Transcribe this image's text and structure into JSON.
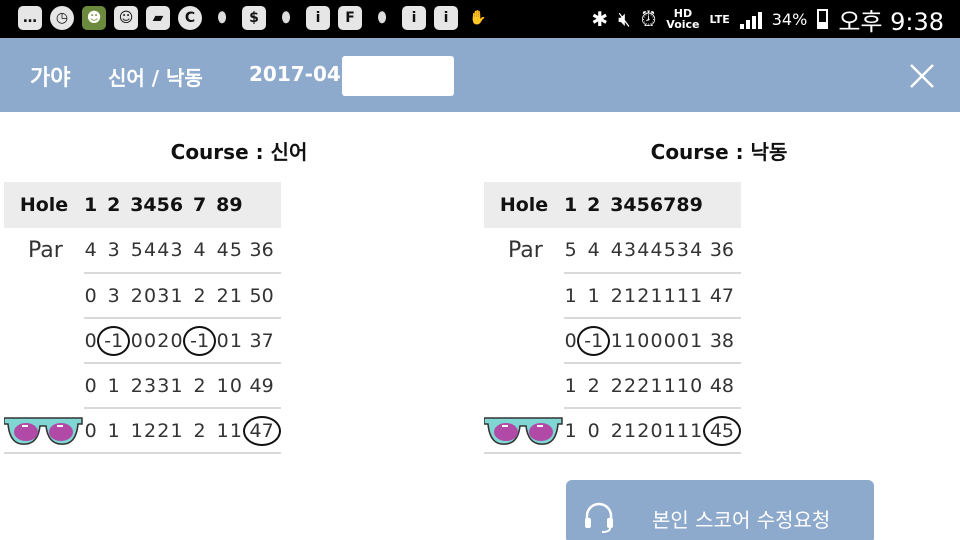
{
  "status_bar": {
    "left_icons": [
      "message-icon",
      "clock-icon",
      "game-icon",
      "emoji-icon",
      "note-icon",
      "c-icon",
      "pill-icon",
      "s-icon",
      "pill-icon",
      "info-icon",
      "f-icon",
      "pill-icon",
      "info-icon",
      "info-icon",
      "hand-icon"
    ],
    "hd_label": "HD",
    "voice_label": "Voice",
    "lte_label": "LTE",
    "battery": "34%",
    "time": "오후 9:38"
  },
  "header": {
    "club": "가야",
    "courses": "신어 / 낙동",
    "date_visible": "2017-04",
    "close_icon": "close-icon"
  },
  "cards": [
    {
      "title": "Course : 신어",
      "hole_label": "Hole",
      "holes": [
        "1",
        "2",
        "3",
        "4",
        "5",
        "6",
        "7",
        "8",
        "9"
      ],
      "par_label": "Par",
      "par": [
        "4",
        "3",
        "5",
        "4",
        "4",
        "3",
        "4",
        "4",
        "5",
        "36"
      ],
      "rows": [
        [
          "0",
          "3",
          "2",
          "0",
          "3",
          "1",
          "2",
          "2",
          "1",
          "50"
        ],
        [
          "0",
          "-1",
          "0",
          "0",
          "2",
          "0",
          "-1",
          "0",
          "1",
          "37"
        ],
        [
          "0",
          "1",
          "2",
          "3",
          "3",
          "1",
          "2",
          "1",
          "0",
          "49"
        ],
        [
          "0",
          "1",
          "1",
          "2",
          "2",
          "1",
          "2",
          "1",
          "1",
          "47"
        ]
      ]
    },
    {
      "title": "Course : 낙동",
      "hole_label": "Hole",
      "holes": [
        "1",
        "2",
        "3",
        "4",
        "5",
        "6",
        "7",
        "8",
        "9"
      ],
      "par_label": "Par",
      "par": [
        "5",
        "4",
        "4",
        "3",
        "4",
        "4",
        "5",
        "3",
        "4",
        "36"
      ],
      "rows": [
        [
          "1",
          "1",
          "2",
          "1",
          "2",
          "1",
          "1",
          "1",
          "1",
          "47"
        ],
        [
          "0",
          "-1",
          "1",
          "1",
          "0",
          "0",
          "0",
          "0",
          "1",
          "38"
        ],
        [
          "1",
          "2",
          "2",
          "2",
          "2",
          "1",
          "1",
          "1",
          "0",
          "48"
        ],
        [
          "1",
          "0",
          "2",
          "1",
          "2",
          "0",
          "1",
          "1",
          "1",
          "45"
        ]
      ]
    }
  ],
  "edit_button": {
    "label": "본인 스코어 수정요청",
    "icon": "headset-icon"
  },
  "colors": {
    "header_bg": "#8da9cc",
    "table_header_bg": "#ececec",
    "row_border": "#d9d9d9"
  }
}
